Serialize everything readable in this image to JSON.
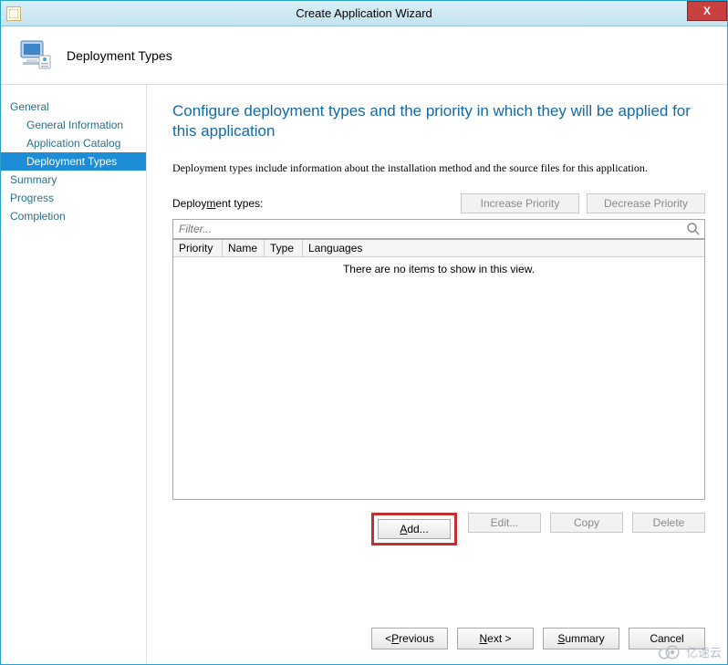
{
  "titlebar": {
    "title": "Create Application Wizard",
    "close_label": "X"
  },
  "banner": {
    "title": "Deployment Types"
  },
  "sidebar": {
    "items": [
      {
        "label": "General",
        "level": 0,
        "active": false
      },
      {
        "label": "General Information",
        "level": 1,
        "active": false
      },
      {
        "label": "Application Catalog",
        "level": 1,
        "active": false
      },
      {
        "label": "Deployment Types",
        "level": 1,
        "active": true
      },
      {
        "label": "Summary",
        "level": 0,
        "active": false
      },
      {
        "label": "Progress",
        "level": 0,
        "active": false
      },
      {
        "label": "Completion",
        "level": 0,
        "active": false
      }
    ]
  },
  "main": {
    "heading": "Configure deployment types and the priority in which they will be applied for this application",
    "description": "Deployment types include information about the installation method and the source files for this application.",
    "deployment_label": "Deployment types:",
    "increase_btn": "Increase Priority",
    "decrease_btn": "Decrease Priority",
    "filter_placeholder": "Filter...",
    "columns": [
      "Priority",
      "Name",
      "Type",
      "Languages"
    ],
    "empty_text": "There are no items to show in this view.",
    "add_btn": "Add...",
    "edit_btn": "Edit...",
    "copy_btn": "Copy",
    "delete_btn": "Delete"
  },
  "footer": {
    "previous": "< Previous",
    "next": "Next >",
    "summary": "Summary",
    "cancel": "Cancel"
  },
  "watermark": "亿速云"
}
